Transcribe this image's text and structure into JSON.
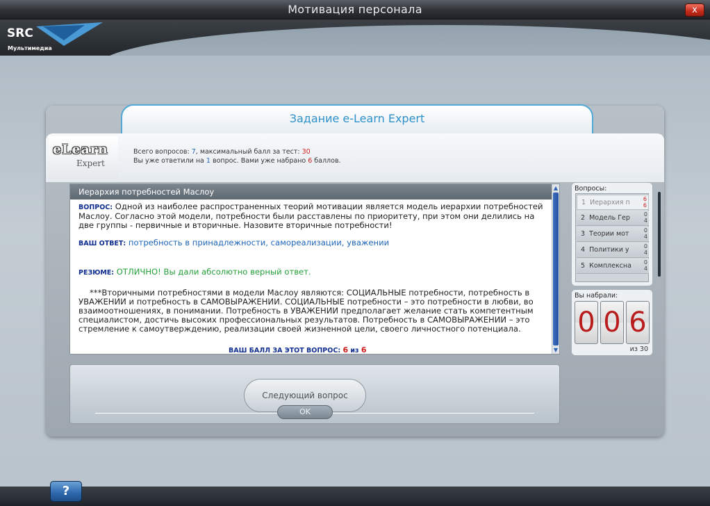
{
  "window": {
    "title": "Мотивация персонала",
    "close_label": "x"
  },
  "logo": {
    "text": "SRC",
    "subtitle": "Мультимедиа"
  },
  "panel": {
    "title": "Задание e-Learn Expert"
  },
  "elearn_logo": {
    "line1": "eLearn",
    "line2": "Expert"
  },
  "stats": {
    "line1_prefix": "Всего вопросов: ",
    "total_questions": "7",
    "line1_middle": ", максимальный балл за тест: ",
    "max_score": "30",
    "line2_prefix": "Вы уже ответили на ",
    "answered_count": "1",
    "line2_middle": " вопрос. Вами уже набрано ",
    "points_earned": "6",
    "line2_suffix": " баллов."
  },
  "question": {
    "header": "Иерархия потребностей Маслоу",
    "question_label": "ВОПРОС:",
    "question_text": " Одной из наиболее распространенных теорий мотивации является модель иерархии потребностей Маслоу. Согласно этой модели, потребности были расставлены по приоритету, при этом они делились на две группы - первичные и вторичные. Назовите вторичные потребности!",
    "answer_label": "ВАШ ОТВЕТ:",
    "answer_text": " потребность в принадлежности, самореализации, уважении",
    "result_label": "РЕЗЮМЕ:",
    "result_text": " ОТЛИЧНО! Вы дали абсолютно верный ответ.",
    "explanation": "***Вторичными потребностями в модели Маслоу являются: СОЦИАЛЬНЫЕ потребности, потребность в УВАЖЕНИИ и потребность в САМОВЫРАЖЕНИИ. СОЦИАЛЬНЫЕ потребности – это потребности в любви, во взаимоотношениях, в понимании. Потребность в УВАЖЕНИИ предполагает желание стать компетентным специалистом, достичь высоких профессиональных результатов. Потребность в САМОВЫРАЖЕНИИ – это стремление к самоутверждению, реализации своей жизненной цели, своего личностного потенциала.",
    "score_label": "ВАШ БАЛЛ ЗА ЭТОТ ВОПРОС: ",
    "score_value": "6",
    "score_of_word": " из ",
    "score_max": "6"
  },
  "questions_panel": {
    "title": "Вопросы:",
    "items": [
      {
        "number": "1",
        "label": "Иерархия п",
        "score_top": "6",
        "score_bottom": "6"
      },
      {
        "number": "2",
        "label": "Модель Гер",
        "score_top": "0",
        "score_bottom": "4"
      },
      {
        "number": "3",
        "label": "Теории мот",
        "score_top": "0",
        "score_bottom": "4"
      },
      {
        "number": "4",
        "label": "Политики у",
        "score_top": "0",
        "score_bottom": "4"
      },
      {
        "number": "5",
        "label": "Комплексна",
        "score_top": "0",
        "score_bottom": "4"
      }
    ]
  },
  "score_box": {
    "title": "Вы набрали:",
    "digits": [
      "0",
      "0",
      "6"
    ],
    "of_text": "из 30"
  },
  "buttons": {
    "next_question": "Следующий вопрос",
    "ok": "OK",
    "help": "?"
  },
  "colors": {
    "accent_blue": "#2e90c8",
    "label_navy": "#0f2e8e",
    "answer_blue": "#1f66b8",
    "result_green": "#26a03a",
    "score_red": "#cc1c1c"
  }
}
